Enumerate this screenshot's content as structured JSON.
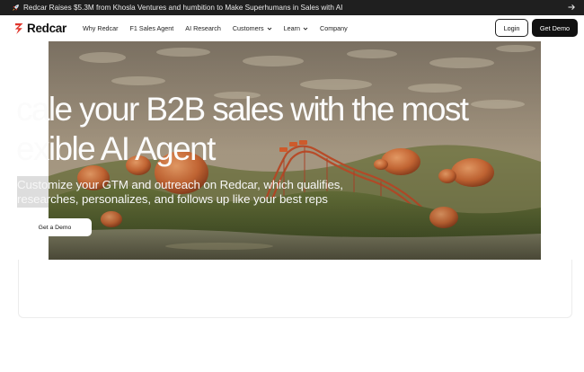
{
  "announcement": {
    "text": "Redcar Raises $5.3M from Khosla Ventures and humbition to Make Superhumans in Sales with AI"
  },
  "brand": {
    "name": "Redcar",
    "accent": "#e0352b"
  },
  "nav": {
    "items": [
      {
        "label": "Why Redcar",
        "dropdown": false
      },
      {
        "label": "F1 Sales Agent",
        "dropdown": false
      },
      {
        "label": "AI Research",
        "dropdown": false
      },
      {
        "label": "Customers",
        "dropdown": true
      },
      {
        "label": "Learn",
        "dropdown": true
      },
      {
        "label": "Company",
        "dropdown": false
      }
    ],
    "login_label": "Login",
    "demo_label": "Get Demo"
  },
  "hero": {
    "headline_line1": "cale your B2B sales with the most",
    "headline_line2": "exible AI Agent",
    "subtext": "Customize your GTM and outreach on Redcar, which qualifies, researches, personalizes, and follows up like your best reps",
    "cta_label": "Get a Demo"
  }
}
